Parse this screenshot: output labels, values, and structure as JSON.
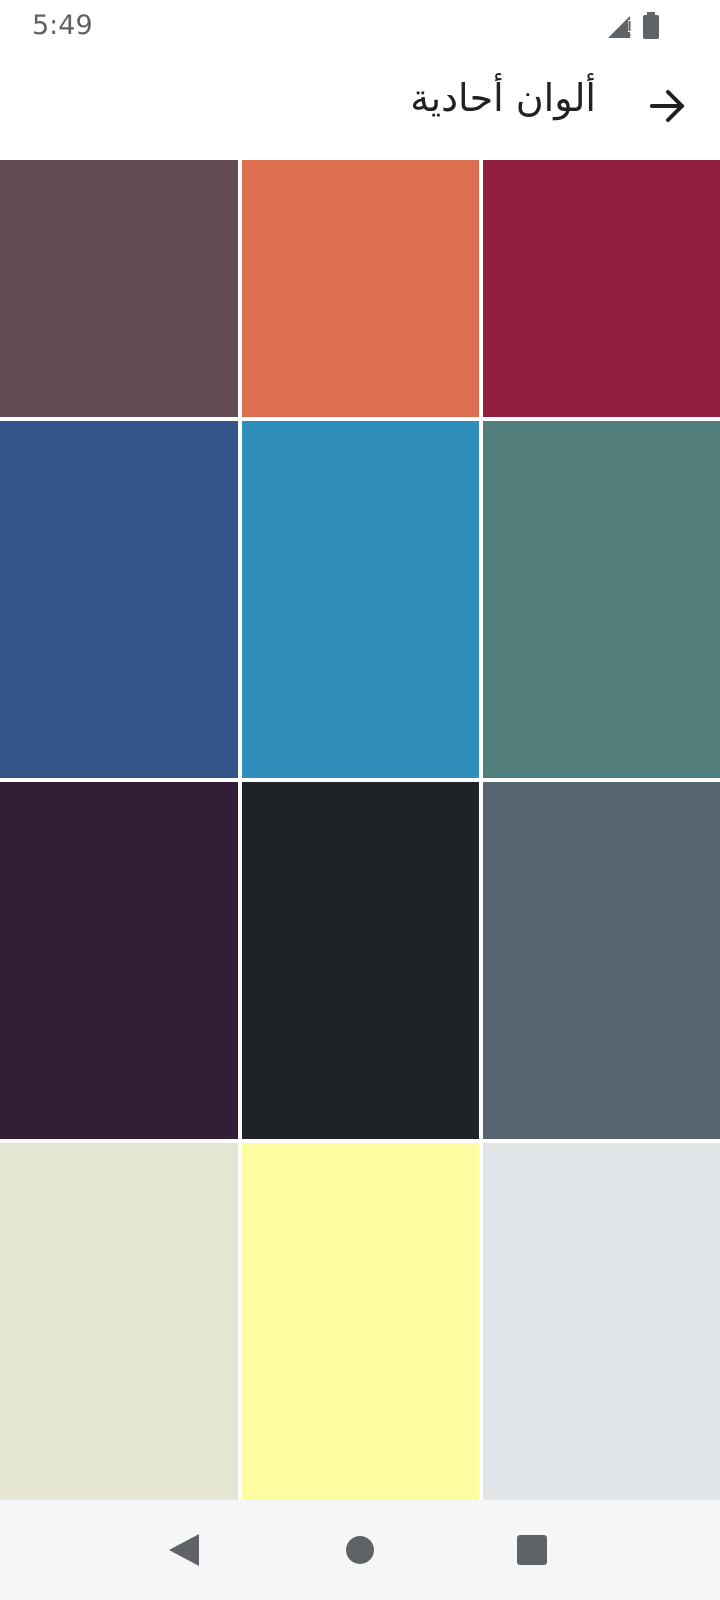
{
  "status_bar": {
    "time": "5:49",
    "icons": [
      "signal-no-data-icon",
      "battery-icon"
    ]
  },
  "app_bar": {
    "title": "ألوان أحادية",
    "back_icon": "arrow-right-icon"
  },
  "swatches": [
    {
      "name": "swatch-1",
      "color": "#634c52"
    },
    {
      "name": "swatch-2",
      "color": "#de6e50"
    },
    {
      "name": "swatch-3",
      "color": "#911f41"
    },
    {
      "name": "swatch-4",
      "color": "#35558a"
    },
    {
      "name": "swatch-5",
      "color": "#2f8fba"
    },
    {
      "name": "swatch-6",
      "color": "#527f7c"
    },
    {
      "name": "swatch-7",
      "color": "#331f35"
    },
    {
      "name": "swatch-8",
      "color": "#1f2328"
    },
    {
      "name": "swatch-9",
      "color": "#576472"
    },
    {
      "name": "swatch-10",
      "color": "#e5e6d1"
    },
    {
      "name": "swatch-11",
      "color": "#fefca0"
    },
    {
      "name": "swatch-12",
      "color": "#e3e6e8"
    }
  ],
  "nav_bar": {
    "icons": [
      "back-triangle-icon",
      "home-circle-icon",
      "recents-square-icon"
    ]
  }
}
